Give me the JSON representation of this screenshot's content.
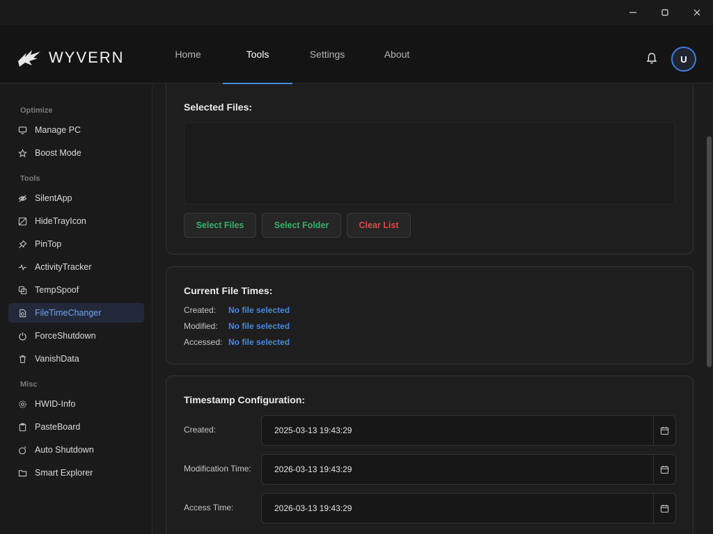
{
  "window": {
    "brand": "WYVERN"
  },
  "nav": {
    "tabs": [
      "Home",
      "Tools",
      "Settings",
      "About"
    ],
    "active": "Tools"
  },
  "user": {
    "avatar_initial": "U"
  },
  "sidebar": {
    "sections": [
      {
        "title": "Optimize",
        "items": [
          {
            "label": "Manage PC",
            "icon": "monitor-icon"
          },
          {
            "label": "Boost Mode",
            "icon": "star-icon"
          }
        ]
      },
      {
        "title": "Tools",
        "items": [
          {
            "label": "SilentApp",
            "icon": "eye-off-icon"
          },
          {
            "label": "HideTrayIcon",
            "icon": "tray-hide-icon"
          },
          {
            "label": "PinTop",
            "icon": "pin-icon"
          },
          {
            "label": "ActivityTracker",
            "icon": "activity-icon"
          },
          {
            "label": "TempSpoof",
            "icon": "copy-icon"
          },
          {
            "label": "FileTimeChanger",
            "icon": "file-clock-icon",
            "active": true
          },
          {
            "label": "ForceShutdown",
            "icon": "power-icon"
          },
          {
            "label": "VanishData",
            "icon": "trash-icon"
          }
        ]
      },
      {
        "title": "Misc",
        "items": [
          {
            "label": "HWID-Info",
            "icon": "gear-icon"
          },
          {
            "label": "PasteBoard",
            "icon": "clipboard-icon"
          },
          {
            "label": "Auto Shutdown",
            "icon": "timer-power-icon"
          },
          {
            "label": "Smart Explorer",
            "icon": "folder-icon"
          }
        ]
      }
    ]
  },
  "selected_files": {
    "title": "Selected Files:",
    "buttons": {
      "select_files": "Select Files",
      "select_folder": "Select Folder",
      "clear_list": "Clear List"
    }
  },
  "current_times": {
    "title": "Current File Times:",
    "rows": [
      {
        "label": "Created:",
        "value": "No file selected"
      },
      {
        "label": "Modified:",
        "value": "No file selected"
      },
      {
        "label": "Accessed:",
        "value": "No file selected"
      }
    ]
  },
  "timestamp_config": {
    "title": "Timestamp Configuration:",
    "rows": [
      {
        "label": "Created:",
        "value": "2025-03-13 19:43:29"
      },
      {
        "label": "Modification Time:",
        "value": "2026-03-13 19:43:29"
      },
      {
        "label": "Access Time:",
        "value": "2026-03-13 19:43:29"
      }
    ]
  },
  "colors": {
    "accent": "#4a8ae6",
    "green": "#33b36a",
    "red": "#e04848",
    "link": "#4a86e0"
  }
}
